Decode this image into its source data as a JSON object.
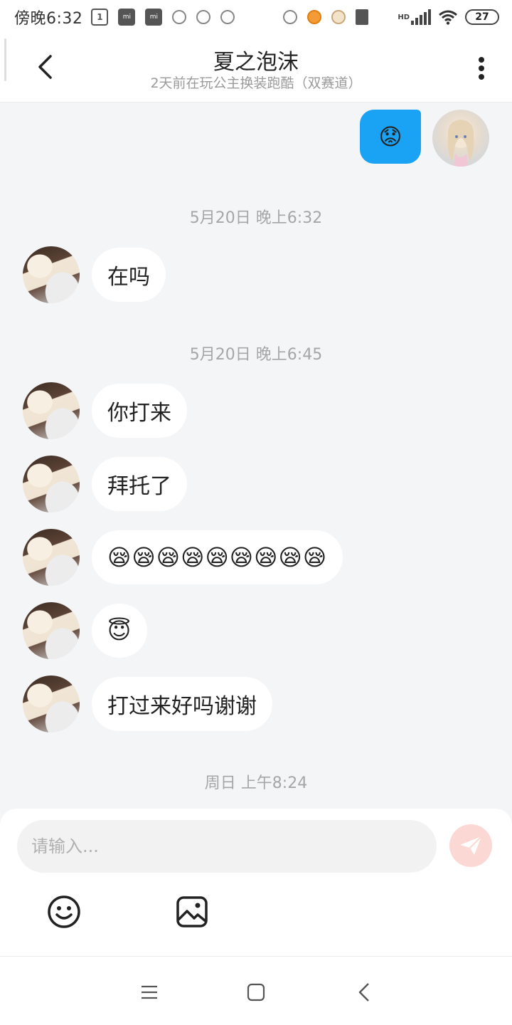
{
  "status_bar": {
    "time": "傍晚6:32",
    "calendar_day": "1",
    "mi_label": "mi",
    "network_label": "HD",
    "battery": "27"
  },
  "header": {
    "title": "夏之泡沫",
    "subtitle": "2天前在玩公主换装跑酷（双赛道）"
  },
  "chat": {
    "my_message": "😟",
    "separators": [
      "5月20日 晚上6:32",
      "5月20日 晚上6:45",
      "周日 上午8:24"
    ],
    "messages": [
      {
        "text": "在吗"
      },
      {
        "text": "你打来"
      },
      {
        "text": "拜托了"
      },
      {
        "text": "😪😪😪😪😪😪😪😪😪"
      },
      {
        "text": "😇"
      },
      {
        "text": "打过来好吗谢谢"
      }
    ]
  },
  "input": {
    "placeholder": "请输入..."
  },
  "icons": {
    "back": "back-arrow-icon",
    "more": "more-vertical-icon",
    "send": "paper-plane-icon",
    "emoji": "smiley-icon",
    "image": "image-icon",
    "nav_menu": "menu-icon",
    "nav_home": "home-square-icon",
    "nav_back": "back-chevron-icon"
  },
  "colors": {
    "accent": "#1aa3f4",
    "send_disabled": "#fbd8d3",
    "background": "#f4f5f7"
  }
}
